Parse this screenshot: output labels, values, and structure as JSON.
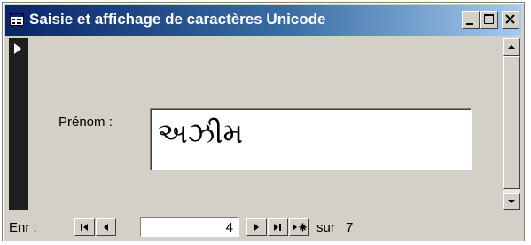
{
  "window": {
    "title": "Saisie et affichage de caractères Unicode",
    "icon": "form-icon",
    "controls": [
      "minimize-icon",
      "maximize-icon",
      "close-icon"
    ]
  },
  "form": {
    "selector_icon": "current-record-arrow-icon",
    "field_label": "Prénom :",
    "field_value": "અઝીમ"
  },
  "navigation": {
    "label": "Enr :",
    "current_record": "4",
    "of_label": "sur",
    "total": "7",
    "buttons": [
      "first-record-icon",
      "previous-record-icon",
      "next-record-icon",
      "last-record-icon",
      "new-record-icon"
    ]
  },
  "colors": {
    "title_bar_start": "#0a246a",
    "title_bar_end": "#a6caf0",
    "face": "#d4d0c8",
    "selector": "#1e1e1e"
  }
}
